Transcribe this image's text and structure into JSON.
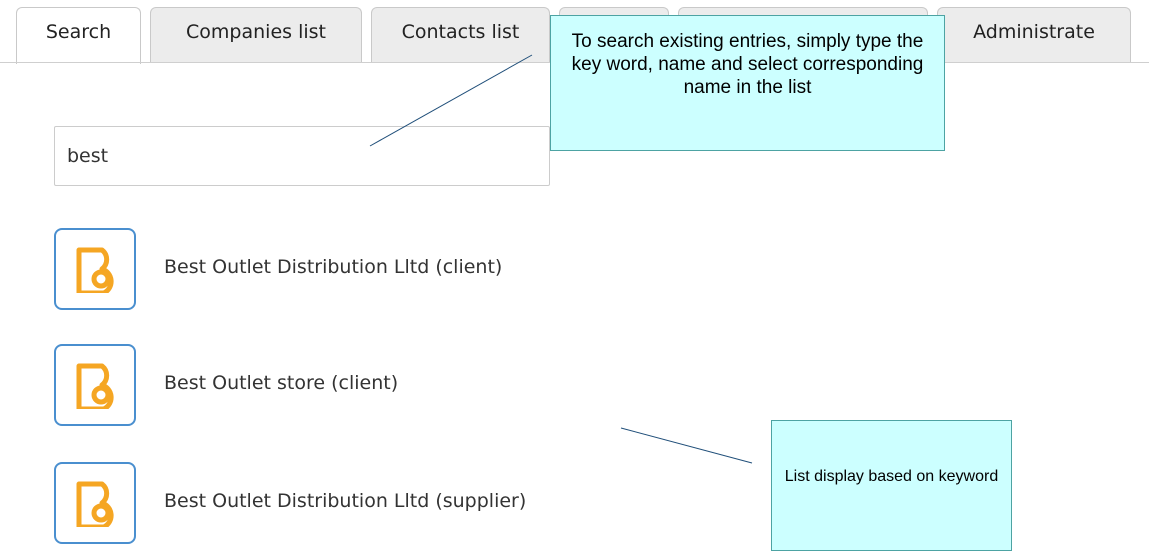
{
  "tabs": [
    {
      "label": "Search",
      "active": true
    },
    {
      "label": "Companies list",
      "active": false
    },
    {
      "label": "Contacts list",
      "active": false
    },
    {
      "label": "",
      "active": false
    },
    {
      "label": "",
      "active": false
    },
    {
      "label": "Administrate",
      "active": false
    }
  ],
  "search": {
    "value": "best",
    "placeholder": ""
  },
  "results": [
    {
      "label": "Best Outlet Distribution Lltd (client)",
      "icon": "company-logo-icon"
    },
    {
      "label": "Best Outlet store (client)",
      "icon": "company-logo-icon"
    },
    {
      "label": "Best Outlet Distribution Lltd (supplier)",
      "icon": "company-logo-icon"
    }
  ],
  "callouts": {
    "search_help": "To search existing entries, simply type the key word, name and select corresponding name in the list",
    "list_help": "List display based on keyword"
  },
  "colors": {
    "icon_border": "#4a8fcf",
    "icon_fill": "#f5a623",
    "callout_bg": "#ccffff"
  }
}
